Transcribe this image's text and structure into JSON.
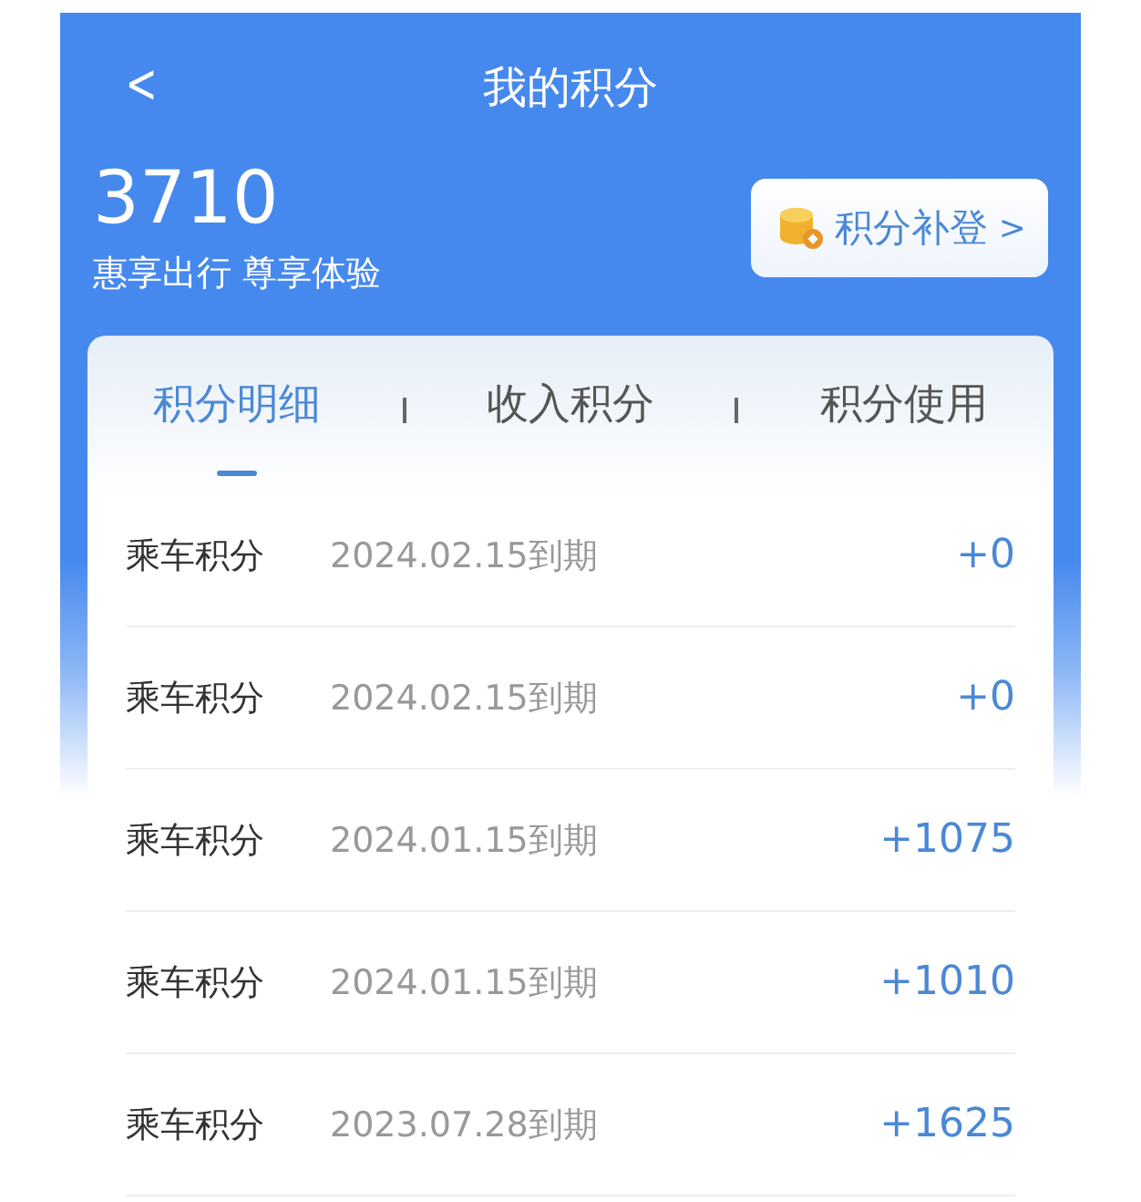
{
  "header": {
    "title": "我的积分",
    "back": "<"
  },
  "summary": {
    "points": "3710",
    "slogan": "惠享出行 尊享体验",
    "action": "积分补登",
    "action_arrow": ">"
  },
  "tabs": [
    {
      "label": "积分明细",
      "selected": true
    },
    {
      "label": "收入积分",
      "selected": false
    },
    {
      "label": "积分使用",
      "selected": false
    }
  ],
  "records": [
    {
      "name": "乘车积分",
      "expiry": "2024.02.15到期",
      "points": "+0"
    },
    {
      "name": "乘车积分",
      "expiry": "2024.02.15到期",
      "points": "+0"
    },
    {
      "name": "乘车积分",
      "expiry": "2024.01.15到期",
      "points": "+1075"
    },
    {
      "name": "乘车积分",
      "expiry": "2024.01.15到期",
      "points": "+1010"
    },
    {
      "name": "乘车积分",
      "expiry": "2023.07.28到期",
      "points": "+1625"
    }
  ]
}
